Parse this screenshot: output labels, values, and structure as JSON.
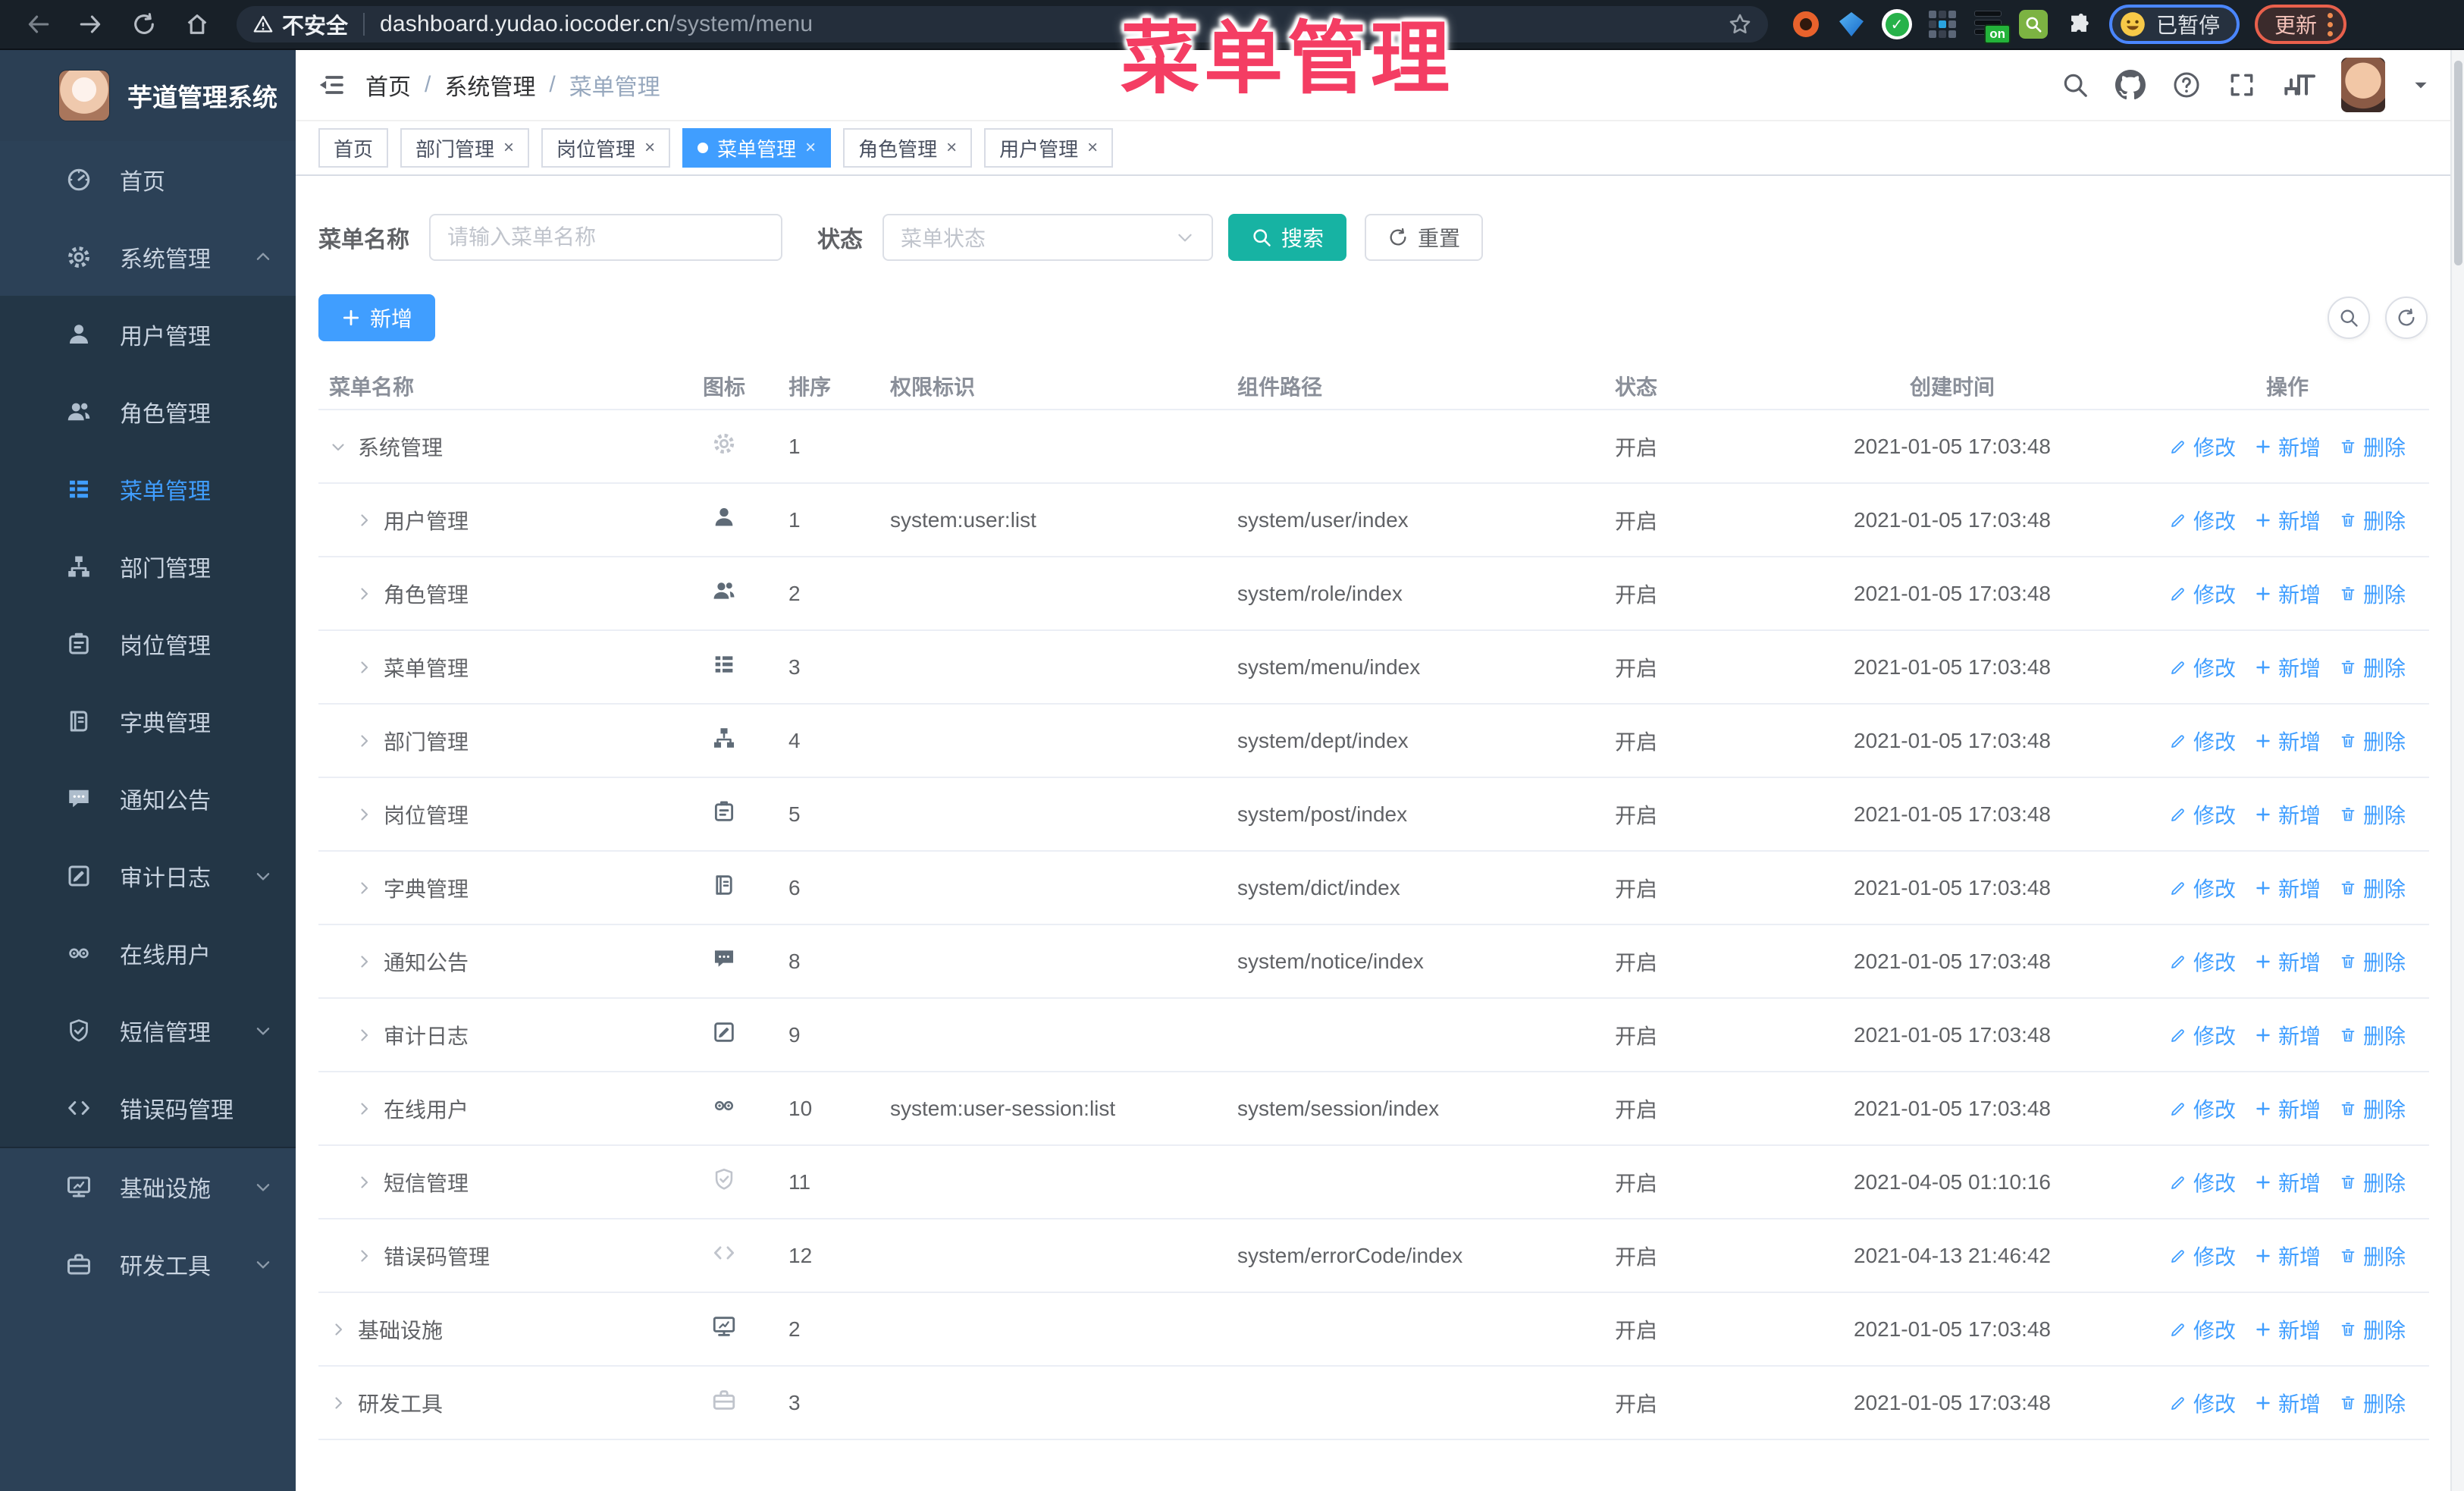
{
  "browser": {
    "security_label": "不安全",
    "url_host": "dashboard.yudao.iocoder.cn",
    "url_path": "/system/menu",
    "extension_on_badge": "on",
    "profile_chip_label": "已暂停",
    "update_button_label": "更新"
  },
  "overlay_title": "菜单管理",
  "colors": {
    "accent": "#409eff",
    "teal": "#17b3a3",
    "annotation_pink": "#f43d63",
    "sidebar_bg": "#2c4157",
    "submenu_bg": "#233646"
  },
  "sidebar": {
    "app_title": "芋道管理系统",
    "items": [
      {
        "label": "首页",
        "icon": "dashboard-icon",
        "level": 0,
        "arrow": ""
      },
      {
        "label": "系统管理",
        "icon": "gear-icon",
        "level": 0,
        "arrow": "up"
      },
      {
        "label": "用户管理",
        "icon": "user-icon",
        "level": 1,
        "arrow": ""
      },
      {
        "label": "角色管理",
        "icon": "users-icon",
        "level": 1,
        "arrow": ""
      },
      {
        "label": "菜单管理",
        "icon": "menu-icon",
        "level": 1,
        "arrow": "",
        "active": true
      },
      {
        "label": "部门管理",
        "icon": "tree-icon",
        "level": 1,
        "arrow": ""
      },
      {
        "label": "岗位管理",
        "icon": "badge-icon",
        "level": 1,
        "arrow": ""
      },
      {
        "label": "字典管理",
        "icon": "dict-icon",
        "level": 1,
        "arrow": ""
      },
      {
        "label": "通知公告",
        "icon": "message-icon",
        "level": 1,
        "arrow": ""
      },
      {
        "label": "审计日志",
        "icon": "log-icon",
        "level": 1,
        "arrow": "down"
      },
      {
        "label": "在线用户",
        "icon": "online-icon",
        "level": 1,
        "arrow": ""
      },
      {
        "label": "短信管理",
        "icon": "shield-icon",
        "level": 1,
        "arrow": "down"
      },
      {
        "label": "错误码管理",
        "icon": "code-icon",
        "level": 1,
        "arrow": ""
      },
      {
        "label": "基础设施",
        "icon": "monitor-icon",
        "level": 0,
        "arrow": "down",
        "section": "base"
      },
      {
        "label": "研发工具",
        "icon": "toolbox-icon",
        "level": 0,
        "arrow": "down",
        "section": "base"
      }
    ]
  },
  "navbar": {
    "breadcrumb": [
      "首页",
      "系统管理",
      "菜单管理"
    ]
  },
  "tabs": [
    {
      "label": "首页",
      "closable": false,
      "active": false
    },
    {
      "label": "部门管理",
      "closable": true,
      "active": false
    },
    {
      "label": "岗位管理",
      "closable": true,
      "active": false
    },
    {
      "label": "菜单管理",
      "closable": true,
      "active": true
    },
    {
      "label": "角色管理",
      "closable": true,
      "active": false
    },
    {
      "label": "用户管理",
      "closable": true,
      "active": false
    }
  ],
  "filter": {
    "name_label": "菜单名称",
    "name_placeholder": "请输入菜单名称",
    "status_label": "状态",
    "status_placeholder": "菜单状态",
    "search_label": "搜索",
    "reset_label": "重置"
  },
  "toolbar": {
    "add_label": "新增"
  },
  "table": {
    "headers": [
      "菜单名称",
      "图标",
      "排序",
      "权限标识",
      "组件路径",
      "状态",
      "创建时间",
      "操作"
    ],
    "action_labels": {
      "edit": "修改",
      "add": "新增",
      "delete": "删除"
    },
    "rows": [
      {
        "name": "系统管理",
        "level": 0,
        "expand": "open",
        "icon": "gear-icon",
        "muted": true,
        "sort": "1",
        "perm": "",
        "path": "",
        "status": "开启",
        "time": "2021-01-05 17:03:48"
      },
      {
        "name": "用户管理",
        "level": 1,
        "expand": "closed",
        "icon": "user-icon",
        "muted": false,
        "sort": "1",
        "perm": "system:user:list",
        "path": "system/user/index",
        "status": "开启",
        "time": "2021-01-05 17:03:48"
      },
      {
        "name": "角色管理",
        "level": 1,
        "expand": "closed",
        "icon": "users-icon",
        "muted": false,
        "sort": "2",
        "perm": "",
        "path": "system/role/index",
        "status": "开启",
        "time": "2021-01-05 17:03:48"
      },
      {
        "name": "菜单管理",
        "level": 1,
        "expand": "closed",
        "icon": "menu-icon",
        "muted": false,
        "sort": "3",
        "perm": "",
        "path": "system/menu/index",
        "status": "开启",
        "time": "2021-01-05 17:03:48"
      },
      {
        "name": "部门管理",
        "level": 1,
        "expand": "closed",
        "icon": "tree-icon",
        "muted": false,
        "sort": "4",
        "perm": "",
        "path": "system/dept/index",
        "status": "开启",
        "time": "2021-01-05 17:03:48"
      },
      {
        "name": "岗位管理",
        "level": 1,
        "expand": "closed",
        "icon": "badge-icon",
        "muted": false,
        "sort": "5",
        "perm": "",
        "path": "system/post/index",
        "status": "开启",
        "time": "2021-01-05 17:03:48"
      },
      {
        "name": "字典管理",
        "level": 1,
        "expand": "closed",
        "icon": "dict-icon",
        "muted": false,
        "sort": "6",
        "perm": "",
        "path": "system/dict/index",
        "status": "开启",
        "time": "2021-01-05 17:03:48"
      },
      {
        "name": "通知公告",
        "level": 1,
        "expand": "closed",
        "icon": "message-icon",
        "muted": false,
        "sort": "8",
        "perm": "",
        "path": "system/notice/index",
        "status": "开启",
        "time": "2021-01-05 17:03:48"
      },
      {
        "name": "审计日志",
        "level": 1,
        "expand": "closed",
        "icon": "log-icon",
        "muted": false,
        "sort": "9",
        "perm": "",
        "path": "",
        "status": "开启",
        "time": "2021-01-05 17:03:48"
      },
      {
        "name": "在线用户",
        "level": 1,
        "expand": "closed",
        "icon": "online-icon",
        "muted": false,
        "sort": "10",
        "perm": "system:user-session:list",
        "path": "system/session/index",
        "status": "开启",
        "time": "2021-01-05 17:03:48"
      },
      {
        "name": "短信管理",
        "level": 1,
        "expand": "closed",
        "icon": "shield-icon",
        "muted": true,
        "sort": "11",
        "perm": "",
        "path": "",
        "status": "开启",
        "time": "2021-04-05 01:10:16"
      },
      {
        "name": "错误码管理",
        "level": 1,
        "expand": "closed",
        "icon": "code-icon",
        "muted": true,
        "sort": "12",
        "perm": "",
        "path": "system/errorCode/index",
        "status": "开启",
        "time": "2021-04-13 21:46:42"
      },
      {
        "name": "基础设施",
        "level": 0,
        "expand": "closed",
        "icon": "monitor-icon",
        "muted": false,
        "sort": "2",
        "perm": "",
        "path": "",
        "status": "开启",
        "time": "2021-01-05 17:03:48"
      },
      {
        "name": "研发工具",
        "level": 0,
        "expand": "closed",
        "icon": "toolbox-icon",
        "muted": true,
        "sort": "3",
        "perm": "",
        "path": "",
        "status": "开启",
        "time": "2021-01-05 17:03:48"
      }
    ]
  }
}
